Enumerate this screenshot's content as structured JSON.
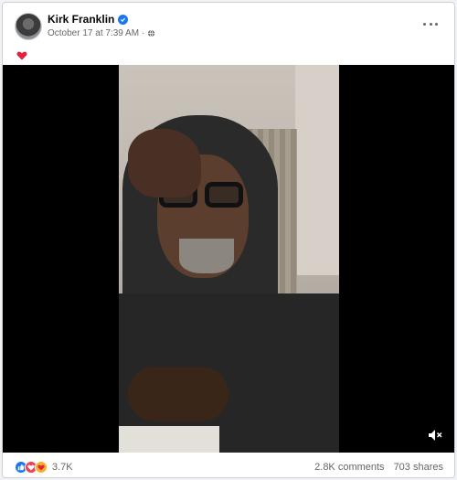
{
  "post": {
    "author": "Kirk Franklin",
    "timestamp": "October 17 at 7:39 AM",
    "meta_separator": "·",
    "privacy_icon": "globe-icon",
    "caption_icon": "heart-emoji-icon"
  },
  "video": {
    "mute_icon": "speaker-muted-icon"
  },
  "footer": {
    "reactions": [
      "like-icon",
      "love-icon",
      "care-icon"
    ],
    "reaction_count": "3.7K",
    "comments": "2.8K comments",
    "shares": "703 shares"
  },
  "colors": {
    "accent": "#1877f2",
    "love": "#f33e58",
    "care": "#f7b125",
    "secondary_text": "#65676b"
  }
}
